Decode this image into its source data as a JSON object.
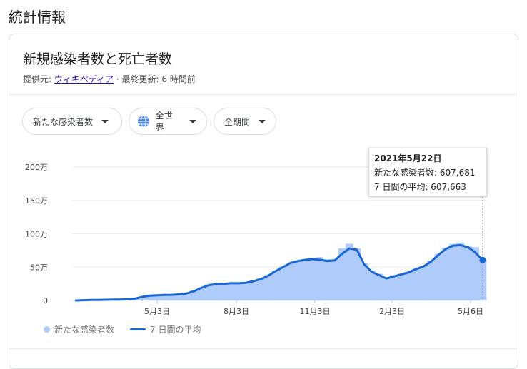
{
  "section_title": "統計情報",
  "card": {
    "title": "新規感染者数と死亡者数",
    "source_label": "提供元: ",
    "source_name": "ウィキペディア",
    "update_text": " · 最終更新: 6 時間前"
  },
  "filters": {
    "cases": "新たな感染者数",
    "region": "全世界",
    "period": "全期間"
  },
  "tooltip": {
    "date": "2021年5月22日",
    "cases_line": "新たな感染者数: 607,681",
    "avg_line": "7 日間の平均: 607,663"
  },
  "legend": {
    "bars": "新たな感染者数",
    "line": "7 日間の平均"
  },
  "colors": {
    "bars": "#aecbfa",
    "line": "#1967d2",
    "grid": "#e8eaed"
  },
  "chart_data": {
    "type": "bar",
    "ylim": [
      0,
      2000000
    ],
    "y_ticks": [
      "0",
      "50万",
      "100万",
      "150万",
      "200万"
    ],
    "x_ticks": [
      "5月3日",
      "8月3日",
      "11月3日",
      "2月3日",
      "5月6日"
    ],
    "series": [
      {
        "name": "新たな感染者数",
        "values": [
          0,
          5000,
          8000,
          10000,
          12000,
          15000,
          15000,
          20000,
          30000,
          60000,
          75000,
          80000,
          85000,
          85000,
          95000,
          110000,
          150000,
          200000,
          240000,
          250000,
          250000,
          265000,
          260000,
          270000,
          300000,
          330000,
          380000,
          450000,
          510000,
          570000,
          600000,
          620000,
          640000,
          650000,
          620000,
          620000,
          780000,
          850000,
          780000,
          560000,
          450000,
          400000,
          340000,
          380000,
          400000,
          430000,
          480000,
          520000,
          600000,
          700000,
          790000,
          850000,
          870000,
          820000,
          800000,
          610000
        ]
      },
      {
        "name": "7 日間の平均",
        "values": [
          0,
          4000,
          7000,
          9000,
          11000,
          13000,
          14000,
          18000,
          28000,
          55000,
          72000,
          78000,
          82000,
          84000,
          92000,
          105000,
          140000,
          190000,
          230000,
          245000,
          248000,
          260000,
          258000,
          265000,
          290000,
          320000,
          370000,
          440000,
          500000,
          560000,
          590000,
          610000,
          620000,
          610000,
          590000,
          600000,
          700000,
          780000,
          760000,
          540000,
          430000,
          380000,
          330000,
          360000,
          390000,
          420000,
          470000,
          510000,
          580000,
          680000,
          770000,
          820000,
          830000,
          800000,
          720000,
          607663
        ]
      }
    ]
  }
}
